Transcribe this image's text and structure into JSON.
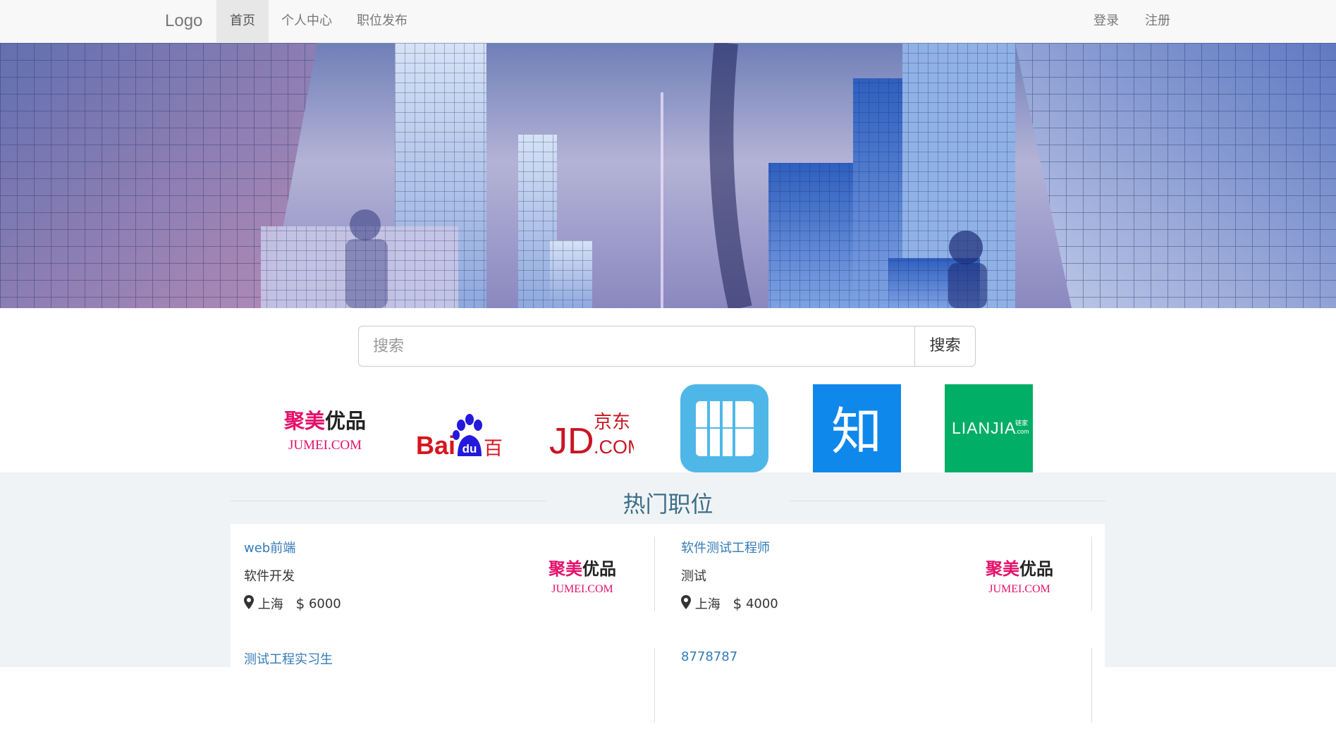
{
  "navbar": {
    "brand": "Logo",
    "items": [
      {
        "label": "首页",
        "active": true
      },
      {
        "label": "个人中心",
        "active": false
      },
      {
        "label": "职位发布",
        "active": false
      }
    ],
    "right_items": [
      {
        "label": "登录"
      },
      {
        "label": "注册"
      }
    ]
  },
  "carousel": {
    "slide_count": 3,
    "active_index": 0,
    "indicator_color": "#1e7fe6"
  },
  "search": {
    "placeholder": "搜索",
    "button_label": "搜索"
  },
  "companies": [
    {
      "name": "jumei",
      "line1": "聚美优品",
      "line2": "JUMEI.COM"
    },
    {
      "name": "baidu",
      "line1": "Bai",
      "line1b": "du",
      "line1c": "百度"
    },
    {
      "name": "jd",
      "line1": "JD",
      "line1b": "京东",
      "line2": ".COM"
    },
    {
      "name": "app-icon"
    },
    {
      "name": "zhihu",
      "line1": "知"
    },
    {
      "name": "lianjia",
      "line1": "LIANJIA",
      "line2": "链家",
      "line3": ".com"
    }
  ],
  "hot_jobs": {
    "title": "热门职位",
    "jobs": [
      {
        "title": "web前端",
        "category": "软件开发",
        "city": "上海",
        "salary": "6000",
        "company": "jumei"
      },
      {
        "title": "软件测试工程师",
        "category": "测试",
        "city": "上海",
        "salary": "4000",
        "company": "jumei"
      },
      {
        "title": "测试工程实习生"
      },
      {
        "title": "8778787"
      }
    ]
  },
  "colors": {
    "link": "#337ab7",
    "section_title": "#3c6e87",
    "jumei_pink": "#e5106b",
    "baidu_red": "#d8141e",
    "baidu_blue": "#2319dc",
    "jd_red": "#c81623",
    "zhihu_blue": "#0f88eb",
    "lianjia_green": "#00ae66"
  }
}
